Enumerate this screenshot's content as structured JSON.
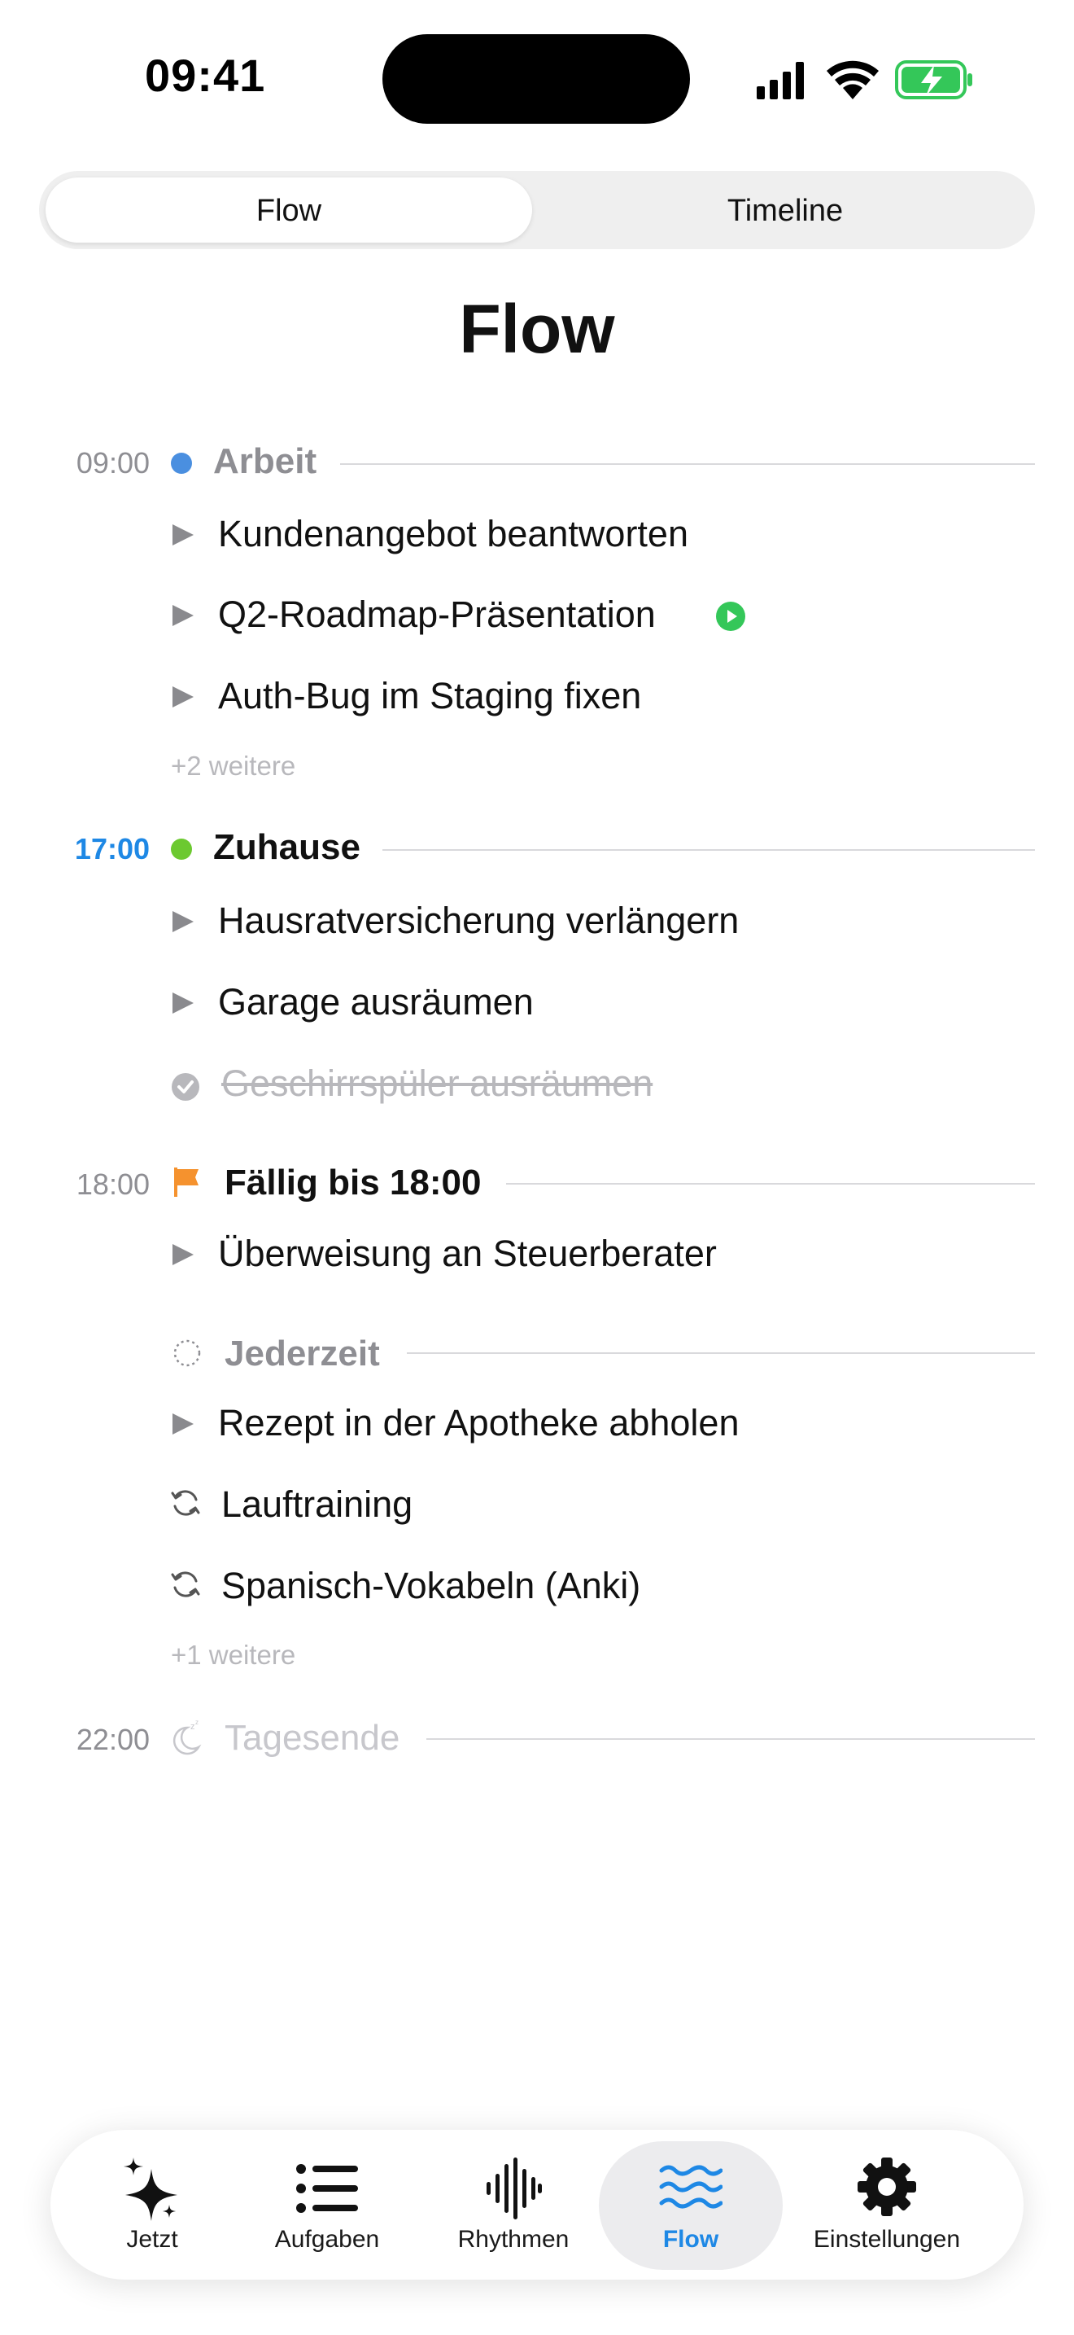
{
  "status_bar": {
    "time": "09:41"
  },
  "segmented": {
    "options": [
      "Flow",
      "Timeline"
    ],
    "selected": "Flow"
  },
  "page_title": "Flow",
  "groups": [
    {
      "time": "09:00",
      "title": "Arbeit",
      "color": "#4a8fe0",
      "tasks": [
        "Kundenangebot beantworten",
        "Q2-Roadmap-Präsentation",
        "Auth-Bug im Staging fixen"
      ],
      "more": "+2 weitere"
    },
    {
      "time": "17:00",
      "title": "Zuhause",
      "color": "#6cc930",
      "tasks": [
        "Hausratversicherung verlängern",
        "Garage ausräumen",
        "Geschirrspüler ausräumen"
      ]
    },
    {
      "time": "18:00",
      "title": "Fällig bis 18:00",
      "color": "#f5922e",
      "tasks": [
        "Überweisung an Steuerberater"
      ]
    },
    {
      "title": "Jederzeit",
      "tasks": [
        "Rezept in der Apotheke abholen",
        "Lauftraining",
        "Spanisch-Vokabeln (Anki)"
      ],
      "more": "+1 weitere"
    },
    {
      "time": "22:00",
      "title": "Tagesende"
    }
  ],
  "tabs": [
    "Jetzt",
    "Aufgaben",
    "Rhythmen",
    "Flow",
    "Einstellungen"
  ],
  "active_tab": "Flow",
  "colors": {
    "accent": "#1e88e5",
    "playing": "#34c759",
    "done": "#b8b8bc"
  },
  "icons": [
    "sparkles-icon",
    "list-icon",
    "waveform-icon",
    "waves-icon",
    "gear-icon",
    "flag-icon",
    "moon-icon",
    "repeat-icon"
  ]
}
